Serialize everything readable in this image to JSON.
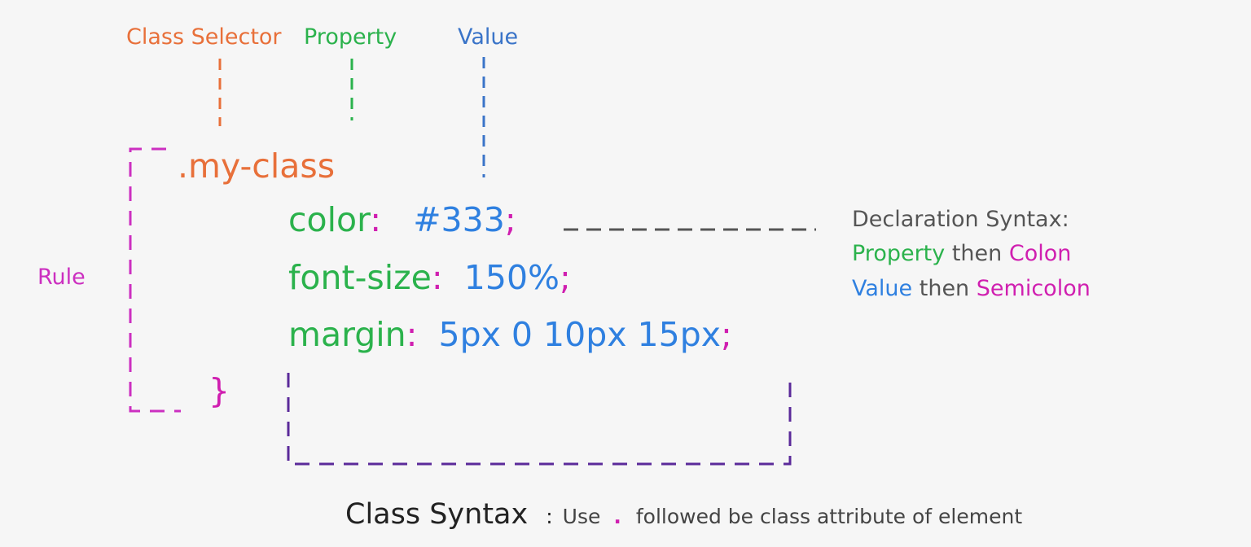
{
  "colors": {
    "selector": "#e8703a",
    "property": "#2bb24c",
    "value": "#2f80e0",
    "value_label": "#3a74c8",
    "punctuation": "#d01fb0",
    "rule": "#cc2fc0",
    "declaration_box": "#5b2a9a",
    "connector": "#555555",
    "text_dark": "#222222",
    "text_gray": "#555555"
  },
  "labels": {
    "class_selector": "Class Selector",
    "property": "Property",
    "value": "Value",
    "rule": "Rule"
  },
  "code": {
    "selector": ".my-class",
    "declarations": [
      {
        "property": "color",
        "colon": ":",
        "value": "#333",
        "semicolon": ";"
      },
      {
        "property": "font-size",
        "colon": ":",
        "value": "150%",
        "semicolon": ";"
      },
      {
        "property": "margin",
        "colon": ":",
        "value": "5px 0 10px 15px",
        "semicolon": ";"
      }
    ],
    "closing_brace": "}"
  },
  "declaration_note": {
    "title": "Declaration Syntax:",
    "line1": {
      "property": "Property",
      "then": "then",
      "colon": "Colon"
    },
    "line2": {
      "value": "Value",
      "then": "then",
      "semicolon": "Semicolon"
    }
  },
  "footer": {
    "title": "Class Syntax",
    "separator": ":",
    "use": "Use",
    "dot": ".",
    "description": "followed be class attribute of element"
  }
}
